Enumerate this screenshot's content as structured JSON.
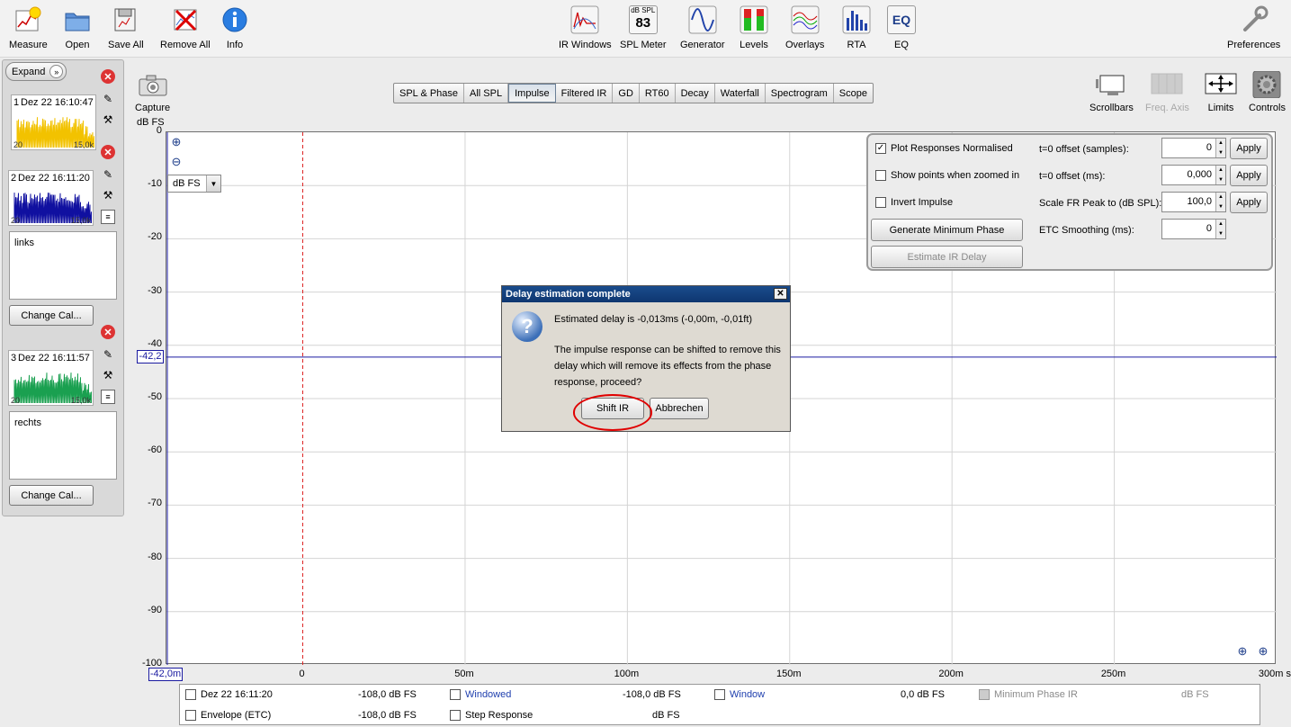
{
  "toolbar": {
    "left": [
      {
        "label": "Measure",
        "icon": "measure-icon"
      },
      {
        "label": "Open",
        "icon": "folder-icon"
      },
      {
        "label": "Save All",
        "icon": "save-all-icon"
      },
      {
        "label": "Remove All",
        "icon": "remove-all-icon"
      },
      {
        "label": "Info",
        "icon": "info-icon"
      }
    ],
    "center": [
      {
        "label": "IR Windows",
        "icon": "ir-windows-icon"
      },
      {
        "label": "SPL Meter",
        "icon": "spl-meter-icon",
        "meter_unit": "dB SPL",
        "meter_value": "83"
      },
      {
        "label": "Generator",
        "icon": "generator-icon"
      },
      {
        "label": "Levels",
        "icon": "levels-icon"
      },
      {
        "label": "Overlays",
        "icon": "overlays-icon"
      },
      {
        "label": "RTA",
        "icon": "rta-icon"
      },
      {
        "label": "EQ",
        "icon": "eq-icon",
        "glyph": "EQ"
      }
    ],
    "preferences": "Preferences"
  },
  "sidebar": {
    "expand_label": "Expand",
    "measurements": [
      {
        "num": "1",
        "timestamp": "Dez 22 16:10:47",
        "lo": "20",
        "hi": "15,0k",
        "color": "#f2c200",
        "note": ""
      },
      {
        "num": "2",
        "timestamp": "Dez 22 16:11:20",
        "lo": "20",
        "hi": "15,0k",
        "color": "#1010a0",
        "note": "links",
        "cal_label": "Change Cal..."
      },
      {
        "num": "3",
        "timestamp": "Dez 22 16:11:57",
        "lo": "20",
        "hi": "15,0k",
        "color": "#1aa050",
        "note": "rechts",
        "cal_label": "Change Cal..."
      }
    ]
  },
  "capture_label": "Capture",
  "tabs": [
    {
      "label": "SPL & Phase",
      "active": false
    },
    {
      "label": "All SPL",
      "active": false
    },
    {
      "label": "Impulse",
      "active": true
    },
    {
      "label": "Filtered IR",
      "active": false
    },
    {
      "label": "GD",
      "active": false
    },
    {
      "label": "RT60",
      "active": false
    },
    {
      "label": "Decay",
      "active": false
    },
    {
      "label": "Waterfall",
      "active": false
    },
    {
      "label": "Spectrogram",
      "active": false
    },
    {
      "label": "Scope",
      "active": false
    }
  ],
  "view_tools": [
    {
      "label": "Scrollbars",
      "enabled": true
    },
    {
      "label": "Freq. Axis",
      "enabled": false
    },
    {
      "label": "Limits",
      "enabled": true
    },
    {
      "label": "Controls",
      "enabled": true
    }
  ],
  "plot": {
    "y_unit": "dB FS",
    "unit_select": "dB FS",
    "cursor_y": "-42,2",
    "cursor_x": "-42,0m"
  },
  "chart_data": {
    "type": "line",
    "ylabel": "dB FS",
    "ylim": [
      -100,
      0
    ],
    "yticks": [
      "0",
      "-10",
      "-20",
      "-30",
      "-40",
      "-50",
      "-60",
      "-70",
      "-80",
      "-90",
      "-100"
    ],
    "xlim_ms": [
      -42,
      300
    ],
    "xticks": [
      {
        "v": 0,
        "label": "0"
      },
      {
        "v": 50,
        "label": "50m"
      },
      {
        "v": 100,
        "label": "100m"
      },
      {
        "v": 150,
        "label": "150m"
      },
      {
        "v": 200,
        "label": "200m"
      },
      {
        "v": 250,
        "label": "250m"
      },
      {
        "v": 300,
        "label": "300m s"
      }
    ],
    "grid": true,
    "cursor_level_db": -42.2,
    "reference_line_ms": 0
  },
  "controls": {
    "plot_normalised": {
      "label": "Plot Responses Normalised",
      "checked": true
    },
    "show_points": {
      "label": "Show points when zoomed in",
      "checked": false
    },
    "invert": {
      "label": "Invert Impulse",
      "checked": false
    },
    "gen_min_phase": "Generate Minimum Phase",
    "estimate_delay": "Estimate IR Delay",
    "fields": [
      {
        "label": "t=0 offset (samples):",
        "value": "0"
      },
      {
        "label": "t=0 offset (ms):",
        "value": "0,000"
      },
      {
        "label": "Scale FR Peak to (dB SPL):",
        "value": "100,0"
      },
      {
        "label": "ETC Smoothing (ms):",
        "value": "0"
      }
    ],
    "apply": "Apply"
  },
  "dialog": {
    "title": "Delay estimation complete",
    "line1": "Estimated delay is -0,013ms (-0,00m, -0,01ft)",
    "line2": "The impulse response can be shifted to remove this",
    "line3": "delay which will remove its effects from the phase",
    "line4": "response, proceed?",
    "ok": "Shift IR",
    "cancel": "Abbrechen",
    "close": "✕"
  },
  "legend": {
    "row1": [
      {
        "label": "Dez 22 16:11:20",
        "value": "-108,0 dB FS",
        "checked": false,
        "link": false
      },
      {
        "label": "Windowed",
        "value": "-108,0 dB FS",
        "checked": false,
        "link": true
      },
      {
        "label": "Window",
        "value": "0,0 dB FS",
        "checked": false,
        "link": true
      },
      {
        "label": "Minimum Phase IR",
        "value": "dB FS",
        "checked": false,
        "link": false,
        "disabled": true
      }
    ],
    "row2": [
      {
        "label": "Envelope (ETC)",
        "value": "-108,0 dB FS",
        "checked": false,
        "link": false
      },
      {
        "label": "Step Response",
        "value": "dB FS",
        "checked": false,
        "link": false
      }
    ]
  }
}
